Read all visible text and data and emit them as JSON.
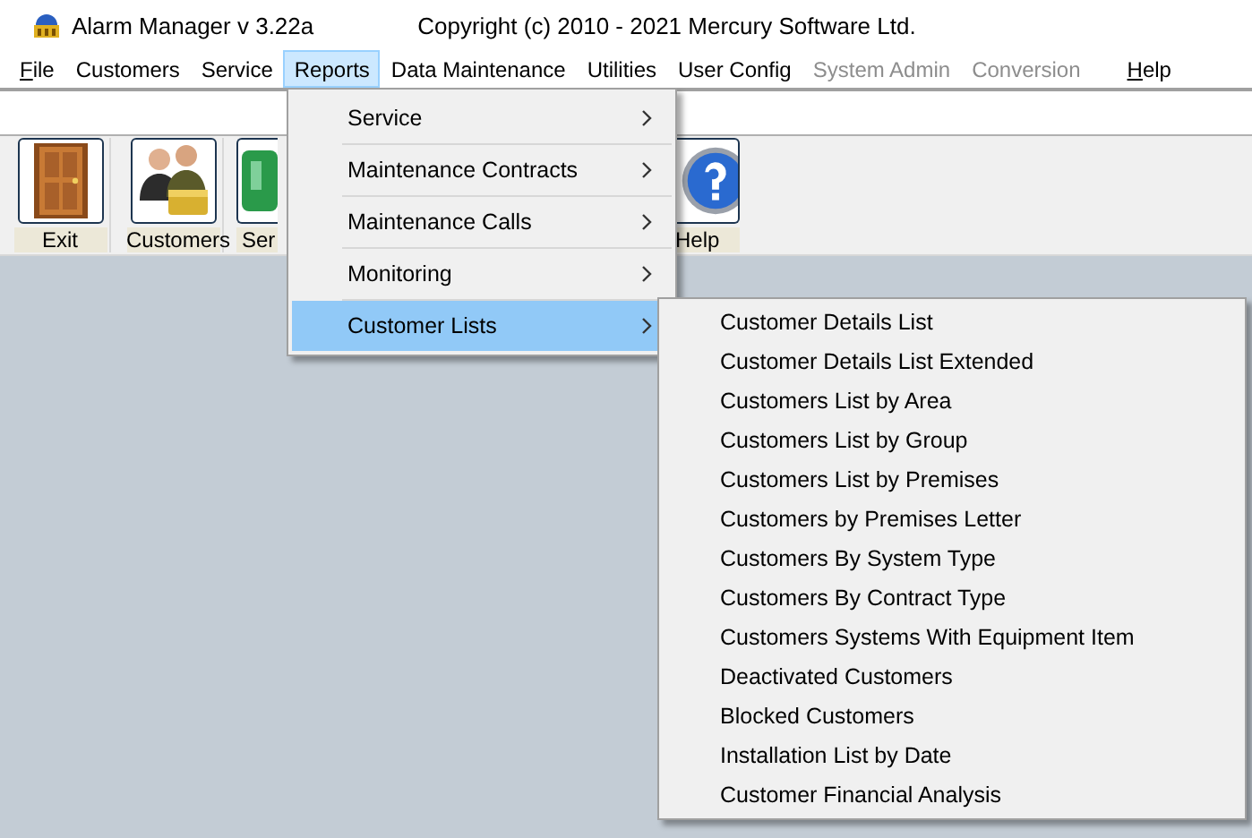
{
  "window": {
    "title": "Alarm Manager v 3.22a",
    "copyright": "Copyright (c) 2010 - 2021 Mercury Software Ltd."
  },
  "menu_bar": [
    {
      "label": "File",
      "mnemonic": true,
      "selected": false,
      "disabled": false
    },
    {
      "label": "Customers",
      "mnemonic": false,
      "selected": false,
      "disabled": false
    },
    {
      "label": "Service",
      "mnemonic": false,
      "selected": false,
      "disabled": false
    },
    {
      "label": "Reports",
      "mnemonic": false,
      "selected": true,
      "disabled": false
    },
    {
      "label": "Data Maintenance",
      "mnemonic": false,
      "selected": false,
      "disabled": false
    },
    {
      "label": "Utilities",
      "mnemonic": false,
      "selected": false,
      "disabled": false
    },
    {
      "label": "User Config",
      "mnemonic": false,
      "selected": false,
      "disabled": false
    },
    {
      "label": "System Admin",
      "mnemonic": false,
      "selected": false,
      "disabled": true
    },
    {
      "label": "Conversion",
      "mnemonic": false,
      "selected": false,
      "disabled": true
    },
    {
      "label": "Help",
      "mnemonic": true,
      "selected": false,
      "disabled": false
    }
  ],
  "toolbar": [
    {
      "label": "Exit",
      "kind": "door"
    },
    {
      "label": "Customers",
      "kind": "people"
    },
    {
      "label": "Ser",
      "kind": "green"
    },
    {
      "label": "Help",
      "kind": "help"
    }
  ],
  "reports_menu": [
    {
      "label": "Service",
      "submenu": true,
      "selected": false
    },
    {
      "label": "Maintenance Contracts",
      "submenu": true,
      "selected": false
    },
    {
      "label": "Maintenance Calls",
      "submenu": true,
      "selected": false
    },
    {
      "label": "Monitoring",
      "submenu": true,
      "selected": false
    },
    {
      "label": "Customer Lists",
      "submenu": true,
      "selected": true
    }
  ],
  "customer_lists_menu": [
    {
      "label": "Customer Details List",
      "selected": false
    },
    {
      "label": "Customer Details List Extended",
      "selected": false
    },
    {
      "label": "Customers List by Area",
      "selected": false
    },
    {
      "label": "Customers List by Group",
      "selected": false
    },
    {
      "label": "Customers List by Premises",
      "selected": false
    },
    {
      "label": "Customers by Premises Letter",
      "selected": false
    },
    {
      "label": "Customers By System Type",
      "selected": false
    },
    {
      "label": "Customers By Contract Type",
      "selected": false
    },
    {
      "label": "Customers Systems With Equipment Item",
      "selected": false
    },
    {
      "label": "Deactivated Customers",
      "selected": false
    },
    {
      "label": "Blocked Customers",
      "selected": false
    },
    {
      "label": "Installation List by Date",
      "selected": false
    },
    {
      "label": "Customer Financial Analysis",
      "selected": false
    }
  ]
}
